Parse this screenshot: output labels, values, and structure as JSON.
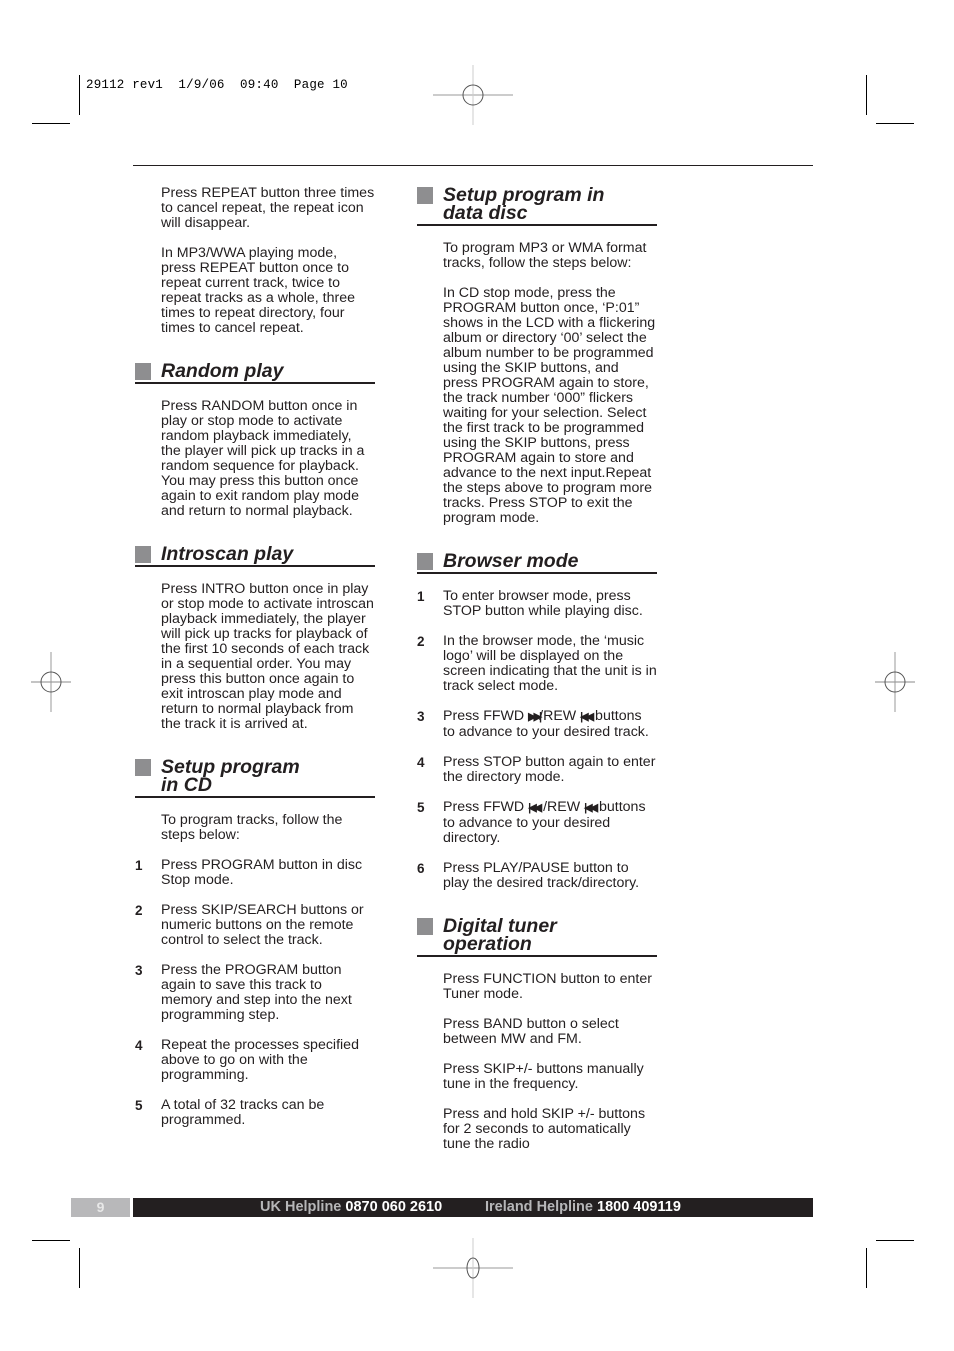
{
  "slug": "29112 rev1  1/9/06  09:40  Page 10",
  "left_column": {
    "intro_paragraphs": [
      "Press REPEAT button three times to cancel repeat, the repeat icon will disappear.",
      "In MP3/WWA playing mode, press REPEAT button once to repeat current track, twice to repeat tracks as a whole, three times to repeat directory, four times to cancel repeat."
    ],
    "random_play": {
      "title": "Random play",
      "body": "Press RANDOM button once in play or stop mode to activate random playback immediately, the player will pick up tracks in a random sequence for playback. You may press this button once again to exit random play mode and return to normal playback."
    },
    "introscan_play": {
      "title": "Introscan play",
      "body": "Press INTRO button once in play or stop mode to activate introscan playback immediately, the player will pick up tracks for playback of the first 10 seconds of each track in a sequential order. You may press this button once again to exit introscan play mode and return to normal playback from the track it is arrived at."
    },
    "setup_cd": {
      "title_line1": "Setup program",
      "title_line2": "in CD",
      "intro": "To program tracks, follow the steps below:",
      "steps": [
        {
          "num": "1",
          "text": "Press PROGRAM button in disc Stop mode."
        },
        {
          "num": "2",
          "text": "Press SKIP/SEARCH buttons or numeric buttons on the remote control to select the track."
        },
        {
          "num": "3",
          "text": "Press the PROGRAM button again to save this track to memory and step into the next programming step."
        },
        {
          "num": "4",
          "text": "Repeat the processes specified above to go on with the programming."
        },
        {
          "num": "5",
          "text": "A total of 32 tracks can be programmed."
        }
      ]
    }
  },
  "right_column": {
    "setup_data": {
      "title_line1": "Setup program in",
      "title_line2": "data disc",
      "paragraphs": [
        "To program MP3 or WMA format tracks, follow the steps below:",
        "In CD stop mode, press the PROGRAM button once, ‘P:01” shows in the LCD with a flickering album or directory ‘00’ select the album number to be programmed using the SKIP buttons, and press PROGRAM again to store, the track number ‘000” flickers waiting for your selection. Select the first track to be programmed using the SKIP buttons, press PROGRAM again to store and advance to the next input.Repeat the steps above to program more tracks. Press STOP to exit the program mode."
      ]
    },
    "browser_mode": {
      "title": "Browser mode",
      "steps": [
        {
          "num": "1",
          "text": "To enter browser mode, press STOP button while playing disc."
        },
        {
          "num": "2",
          "text": "In the browser mode, the ‘music logo’ will be displayed on the screen indicating that the unit is in track select mode."
        },
        {
          "num": "3",
          "pre": "Press FFWD ",
          "icon1": "▶▶|",
          "mid": "/REW ",
          "icon2": "|◀◀",
          "post": " buttons to advance to your desired track."
        },
        {
          "num": "4",
          "text": "Press STOP button again to enter the directory mode."
        },
        {
          "num": "5",
          "pre": "Press FFWD ",
          "icon1": "|◀◀",
          "mid": " /REW ",
          "icon2": "|◀◀",
          "post": " buttons to advance to your desired directory."
        },
        {
          "num": "6",
          "text": "Press PLAY/PAUSE button to play the desired track/directory."
        }
      ]
    },
    "digital_tuner": {
      "title_line1": "Digital tuner",
      "title_line2": "operation",
      "paragraphs": [
        "Press FUNCTION button to enter Tuner mode.",
        "Press BAND button o select between MW and FM.",
        "Press SKIP+/- buttons manually tune in the frequency.",
        "Press and hold SKIP +/- buttons for 2 seconds to automatically tune the radio"
      ]
    }
  },
  "footer": {
    "page_number": "9",
    "uk_label": "UK Helpline",
    "uk_phone": "0870 060 2610",
    "ireland_label": "Ireland Helpline",
    "ireland_phone": "1800 409119"
  }
}
